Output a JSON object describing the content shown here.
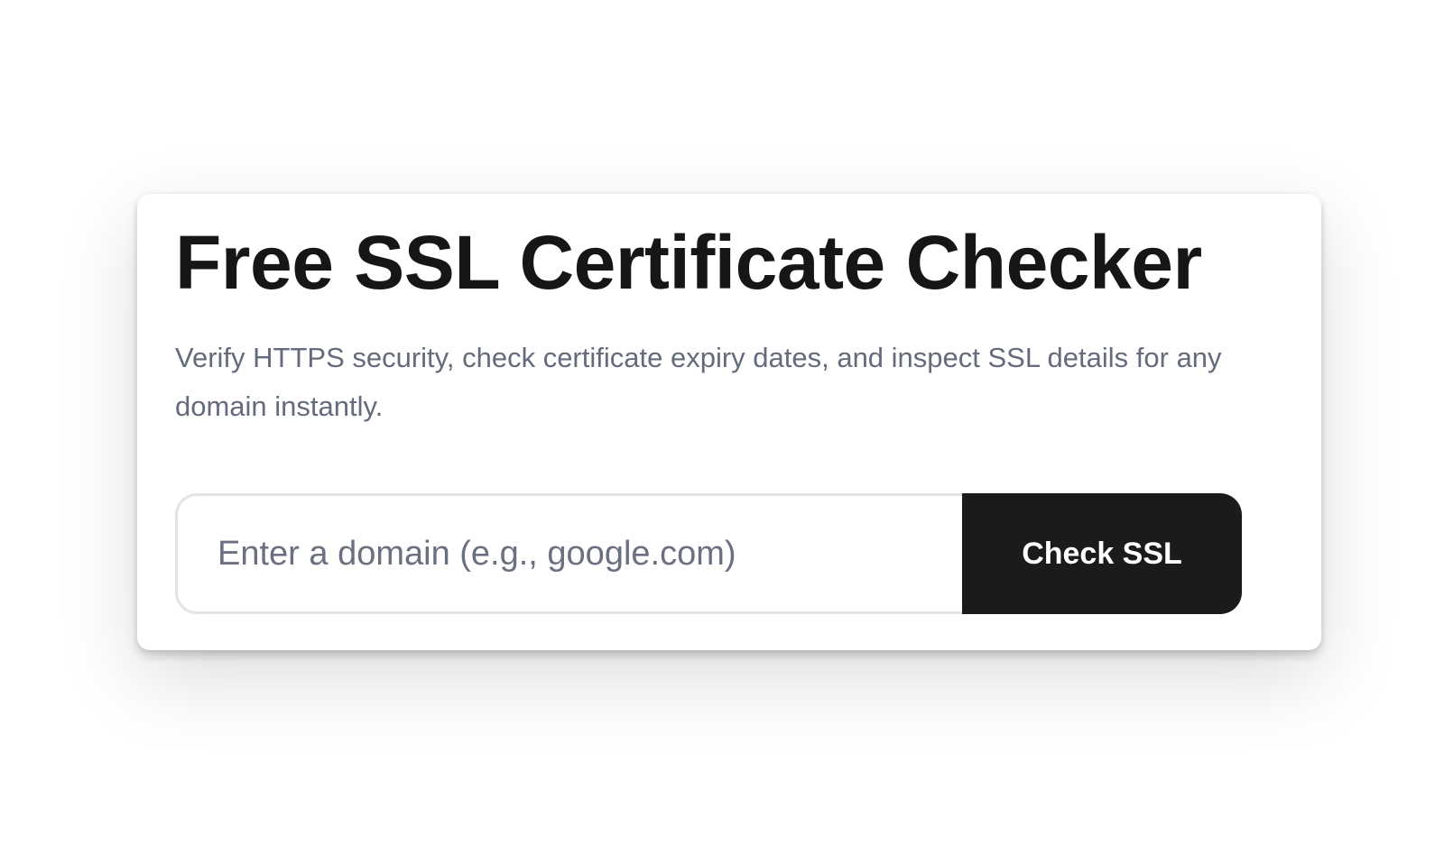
{
  "hero": {
    "title": "Free SSL Certificate Checker",
    "subtitle": "Verify HTTPS security, check certificate expiry dates, and inspect SSL details for any domain instantly."
  },
  "search": {
    "placeholder": "Enter a domain (e.g., google.com)",
    "value": "",
    "button_label": "Check SSL"
  },
  "colors": {
    "background": "#ffffff",
    "card": "#ffffff",
    "title": "#161616",
    "subtitle": "#636b7d",
    "input_border": "#e2e4e8",
    "button_bg": "#1b1b1b",
    "button_text": "#ffffff"
  }
}
